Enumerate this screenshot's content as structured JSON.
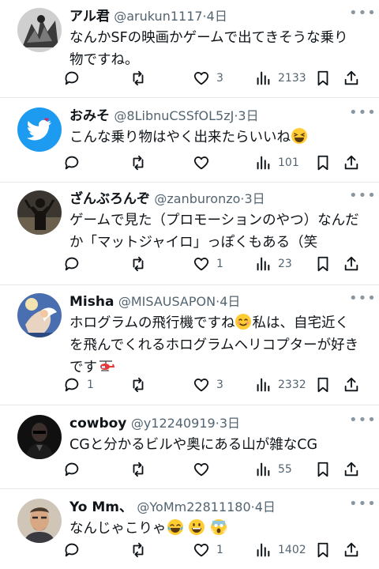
{
  "colors": {
    "accent": "#1d9bf0",
    "text": "#0f1419",
    "muted": "#536471",
    "divider": "#e4e7ea"
  },
  "replies": [
    {
      "name": "アル君",
      "handle": "@arukun1117",
      "sep": "·",
      "time": "4日",
      "text": "なんかSFの映画かゲームで出てきそうな乗り\n物ですね。",
      "reply_count": "",
      "retweet_count": "",
      "like_count": "3",
      "view_count": "2133",
      "avatar_icon": "monochrome-art-avatar"
    },
    {
      "name": "おみそ",
      "handle": "@8LibnuCSSfOL5zJ",
      "sep": "·",
      "time": "3日",
      "text": "こんな乗り物はやく出来たらいいね",
      "emoji": [
        "grinning-squinting-face"
      ],
      "reply_count": "",
      "retweet_count": "",
      "like_count": "",
      "view_count": "101",
      "avatar_icon": "twitter-bird-avatar"
    },
    {
      "name": "ざんぶろんぞ",
      "handle": "@zanburonzo",
      "sep": "·",
      "time": "3日",
      "text": "ゲームで見た（プロモーションのやつ）なんだ\nか「マットジャイロ」っぽくもある（笑",
      "reply_count": "",
      "retweet_count": "",
      "like_count": "1",
      "view_count": "23",
      "avatar_icon": "dark-figure-avatar"
    },
    {
      "name": "Misha",
      "handle": "@MISAUSAPON",
      "sep": "·",
      "time": "4日",
      "text_parts": [
        "ホログラムの飛行機ですね",
        "私は、自宅近く\nを飛んでくれるホログラムヘリコプターが好き\nです"
      ],
      "emoji": [
        "smiling-face",
        "helicopter"
      ],
      "reply_count": "1",
      "retweet_count": "",
      "like_count": "3",
      "view_count": "2332",
      "avatar_icon": "angel-painting-avatar"
    },
    {
      "name": "cowboy",
      "handle": "@y12240919",
      "sep": "·",
      "time": "3日",
      "text": "CGと分かるビルや奥にある山が雑なCG",
      "reply_count": "",
      "retweet_count": "",
      "like_count": "",
      "view_count": "55",
      "avatar_icon": "dark-portrait-avatar"
    },
    {
      "name": "Yo Mm、",
      "handle": "@YoMm22811180",
      "sep": "·",
      "time": "4日",
      "text": "なんじゃこりゃ",
      "emoji": [
        "face-with-tears-of-joy",
        "grinning-face",
        "screaming-face"
      ],
      "reply_count": "",
      "retweet_count": "",
      "like_count": "1",
      "view_count": "1402",
      "avatar_icon": "man-portrait-avatar"
    }
  ]
}
